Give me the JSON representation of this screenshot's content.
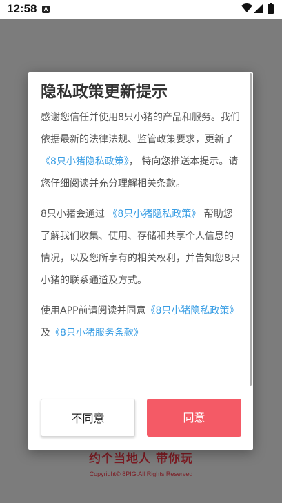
{
  "status_bar": {
    "time": "12:58",
    "notification_glyph": "A",
    "icons": [
      "wifi-icon",
      "signal-icon",
      "battery-icon"
    ]
  },
  "background": {
    "slogan": "约个当地人 带你玩",
    "copyright": "Copyright© 8PIG.All Rights Reserved",
    "slogan_color": "#7d1b23"
  },
  "dialog": {
    "title": "隐私政策更新提示",
    "para1": {
      "text_a": "感谢您信任并使用8只小猪的产品和服务。我们依据最新的法律法规、监管政策要求，更新了",
      "link": "《8只小猪隐私政策》",
      "text_b": "， 特向您推送本提示。请您仔细阅读并充分理解相关条款。"
    },
    "para2": {
      "text_a": "8只小猪会通过",
      "link": "《8只小猪隐私政策》",
      "text_b": "帮助您了解我们收集、使用、存储和共享个人信息的情况，以及您所享有的相关权利，并告知您8只小猪的联系通道及方式。"
    },
    "para3": {
      "text_a": "使用APP前请阅读并同意",
      "link1": "《8只小猪隐私政策》",
      "text_b": "及",
      "link2": "《8只小猪服务条款》"
    },
    "buttons": {
      "disagree": "不同意",
      "agree": "同意"
    },
    "colors": {
      "link": "#3a9ee4",
      "agree_button": "#f45a66"
    }
  }
}
